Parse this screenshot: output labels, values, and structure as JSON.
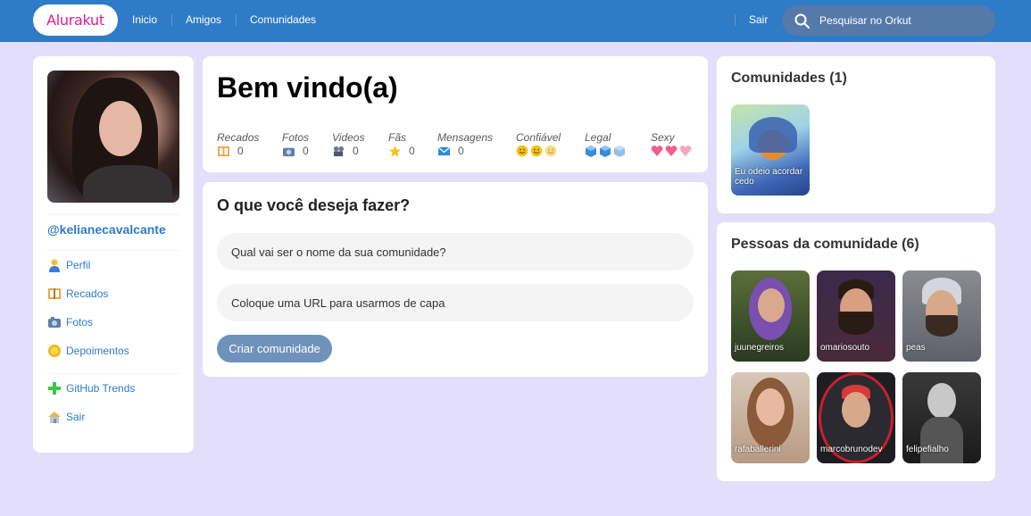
{
  "topbar": {
    "logo": "Alurakut",
    "nav": [
      "Inicio",
      "Amigos",
      "Comunidades"
    ],
    "logout": "Sair",
    "search_placeholder": "Pesquisar no Orkut"
  },
  "profile": {
    "username": "@kelianecavalcante",
    "menu": [
      {
        "label": "Perfil",
        "icon": "user-icon"
      },
      {
        "label": "Recados",
        "icon": "notebook-icon"
      },
      {
        "label": "Fotos",
        "icon": "camera-icon"
      },
      {
        "label": "Depoimentos",
        "icon": "sun-icon"
      },
      {
        "label": "GitHub Trends",
        "icon": "plus-icon"
      },
      {
        "label": "Sair",
        "icon": "home-icon"
      }
    ]
  },
  "welcome": {
    "title": "Bem vindo(a)",
    "stats": [
      {
        "label": "Recados",
        "value": "0",
        "icon": "notebook-icon"
      },
      {
        "label": "Fotos",
        "value": "0",
        "icon": "camera-icon"
      },
      {
        "label": "Videos",
        "value": "0",
        "icon": "video-camera-icon"
      },
      {
        "label": "Fãs",
        "value": "0",
        "icon": "star-icon"
      },
      {
        "label": "Mensagens",
        "value": "0",
        "icon": "envelope-icon"
      }
    ],
    "ratings": [
      {
        "label": "Confiável",
        "icon": "smiley-icon",
        "level": 2
      },
      {
        "label": "Legal",
        "icon": "ice-cube-icon",
        "level": 2
      },
      {
        "label": "Sexy",
        "icon": "heart-icon",
        "level": 2
      }
    ]
  },
  "create": {
    "title": "O que você deseja fazer?",
    "name_placeholder": "Qual vai ser o nome da sua comunidade?",
    "url_placeholder": "Coloque uma URL para usarmos de capa",
    "button": "Criar comunidade"
  },
  "communities": {
    "title": "Comunidades (1)",
    "items": [
      {
        "name": "Eu odeio acordar cedo"
      }
    ]
  },
  "people": {
    "title": "Pessoas da comunidade (6)",
    "items": [
      {
        "name": "juunegreiros"
      },
      {
        "name": "omariosouto"
      },
      {
        "name": "peas"
      },
      {
        "name": "rafaballerini"
      },
      {
        "name": "marcobrunodev"
      },
      {
        "name": "felipefialho"
      }
    ]
  },
  "colors": {
    "topbar": "#2E7BC7",
    "background": "#E3DEFA",
    "link": "#2E7BC7",
    "logo": "#D81D99",
    "button": "#6F92BB"
  }
}
